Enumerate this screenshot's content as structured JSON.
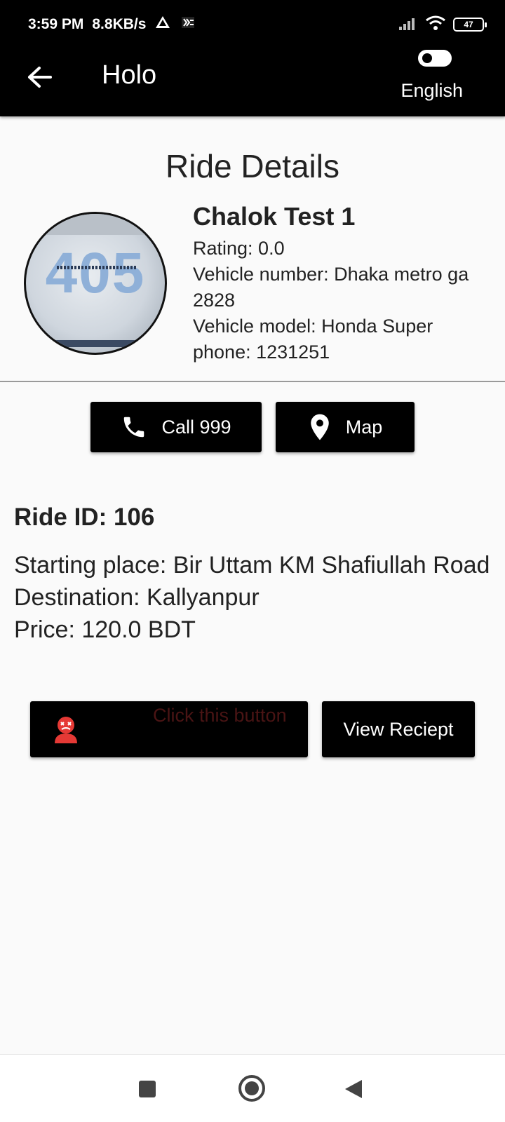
{
  "status_bar": {
    "time": "3:59 PM",
    "speed": "8.8KB/s",
    "battery": "47"
  },
  "app_bar": {
    "title": "Holo",
    "language_label": "English"
  },
  "page": {
    "title": "Ride Details"
  },
  "driver": {
    "photo_text": "405",
    "name": "Chalok Test 1",
    "rating": "Rating: 0.0",
    "vehicle_number_line1": "Vehicle number: Dhaka metro ga",
    "vehicle_number_line2": "2828",
    "vehicle_model": "Vehicle model: Honda Super",
    "phone": "phone: 1231251"
  },
  "actions": {
    "call_label": "Call 999",
    "map_label": "Map"
  },
  "ride": {
    "id_label": "Ride ID: 106",
    "starting_place": "Starting place: Bir Uttam KM Shafiullah Road",
    "destination": "Destination: Kallyanpur",
    "price": "Price: 120.0 BDT"
  },
  "bottom_actions": {
    "feedback_hint": "Click this button",
    "receipt_label": "View Reciept"
  },
  "colors": {
    "bar_background": "#000000",
    "page_background": "#fafafa",
    "sad_icon": "#e53935"
  }
}
